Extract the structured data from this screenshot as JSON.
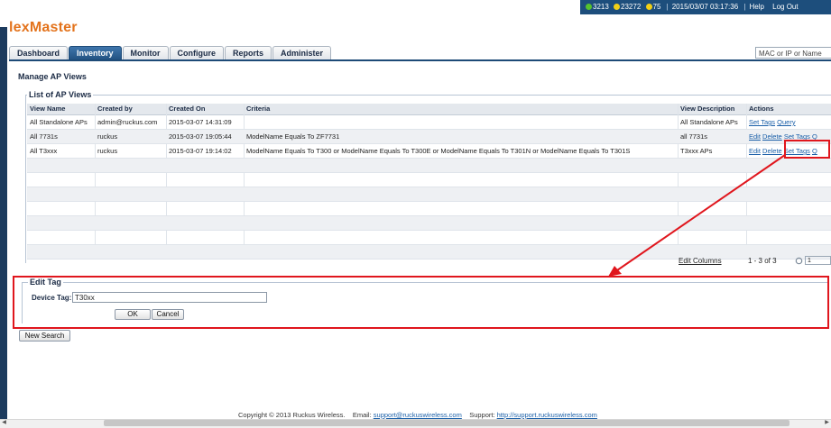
{
  "app": {
    "logo": "lexMaster"
  },
  "status_bar": {
    "count_green": "3213",
    "count_yellow": "23272",
    "count_yellow2": "75",
    "datetime": "2015/03/07 03:17:36",
    "help": "Help",
    "logout": "Log Out",
    "colors": {
      "green": "#56c32d",
      "yellow": "#f2d016",
      "yellow2": "#f2d016"
    }
  },
  "tabs": [
    {
      "label": "Dashboard",
      "active": false
    },
    {
      "label": "Inventory",
      "active": true
    },
    {
      "label": "Monitor",
      "active": false
    },
    {
      "label": "Configure",
      "active": false
    },
    {
      "label": "Reports",
      "active": false
    },
    {
      "label": "Administer",
      "active": false
    }
  ],
  "search": {
    "placeholder": "MAC or IP or Name"
  },
  "page": {
    "title": "Manage AP Views"
  },
  "list": {
    "legend": "List of AP Views",
    "columns": [
      "View Name",
      "Created by",
      "Created On",
      "Criteria",
      "View Description",
      "Actions"
    ],
    "rows": [
      {
        "view_name": "All Standalone APs",
        "created_by": "admin@ruckus.com",
        "created_on": "2015-03-07 14:31:09",
        "criteria": "",
        "description": "All Standalone APs",
        "actions": [
          "Set Tags",
          "Query"
        ]
      },
      {
        "view_name": "All 7731s",
        "created_by": "ruckus",
        "created_on": "2015-03-07 19:05:44",
        "criteria": "ModelName Equals To ZF7731",
        "description": "all 7731s",
        "actions": [
          "Edit",
          "Delete",
          "Set Tags",
          "Q"
        ]
      },
      {
        "view_name": "All T3xxx",
        "created_by": "ruckus",
        "created_on": "2015-03-07 19:14:02",
        "criteria": "ModelName Equals To T300 or ModelName Equals To T300E or ModelName Equals To T301N or ModelName Equals To T301S",
        "description": "T3xxx APs",
        "actions": [
          "Edit",
          "Delete",
          "Set Tags",
          "Q"
        ]
      }
    ],
    "edit_columns": "Edit Columns",
    "range": "1 - 3 of 3",
    "page_value": "1"
  },
  "edit_tag": {
    "legend": "Edit Tag",
    "label": "Device Tag:",
    "value": "T30xx",
    "ok": "OK",
    "cancel": "Cancel"
  },
  "new_search": "New Search",
  "footer": {
    "copyright": "Copyright © 2013 Ruckus Wireless.",
    "email_label": "Email:",
    "email": "support@ruckuswireless.com",
    "support_label": "Support:",
    "support_url": "http://support.ruckuswireless.com"
  }
}
